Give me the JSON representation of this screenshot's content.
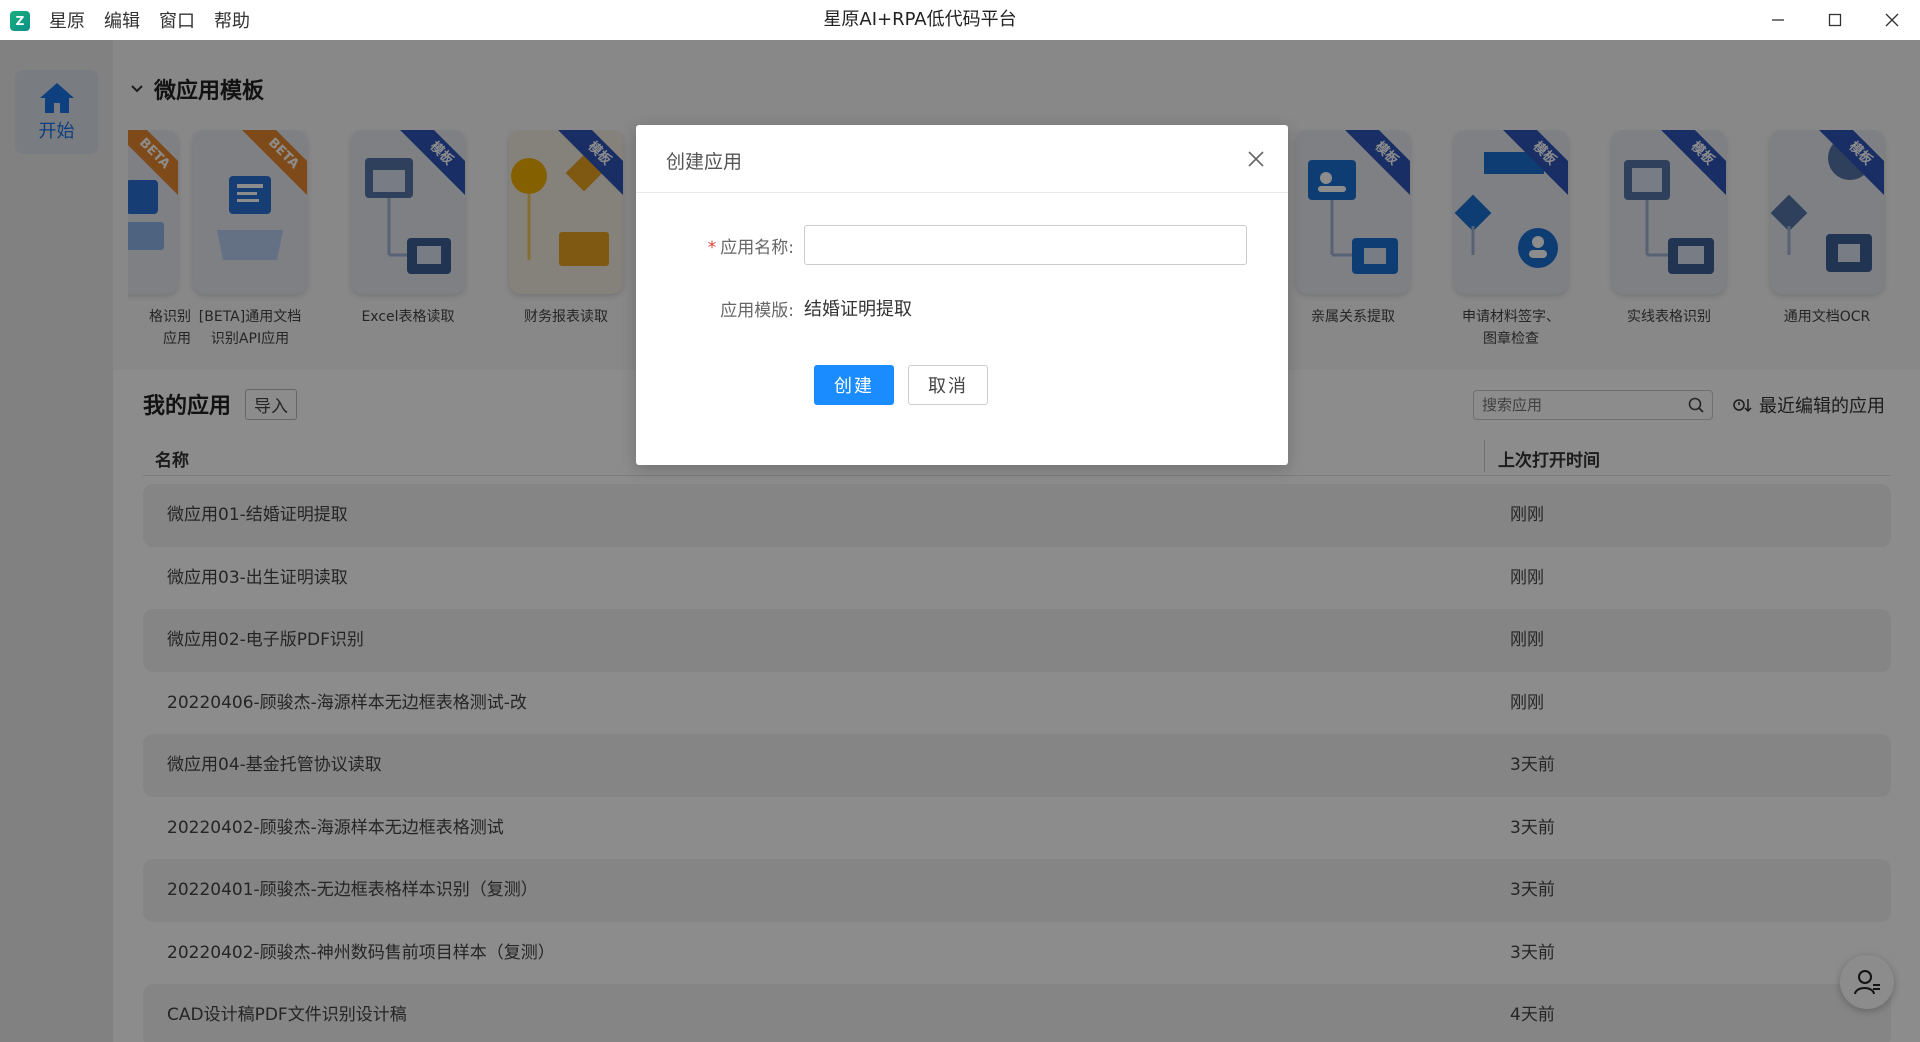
{
  "titlebar": {
    "logo_text": "Z",
    "menu": [
      "星原",
      "编辑",
      "窗口",
      "帮助"
    ],
    "title": "星原AI+RPA低代码平台"
  },
  "sidebar": {
    "start_label": "开始"
  },
  "templates_section": {
    "title": "微应用模板",
    "items": [
      {
        "name": "格识别\n应用",
        "ribbon": "BETA"
      },
      {
        "name": "[BETA]通用文档\n识别API应用",
        "ribbon": "BETA"
      },
      {
        "name": "Excel表格读取",
        "ribbon": "模板"
      },
      {
        "name": "财务报表读取",
        "ribbon": "模板"
      },
      {
        "name": "亲属关系提取",
        "ribbon": "模板"
      },
      {
        "name": "申请材料签字、\n图章检查",
        "ribbon": "模板"
      },
      {
        "name": "实线表格识别",
        "ribbon": "模板"
      },
      {
        "name": "通用文档OCR",
        "ribbon": "模板"
      }
    ]
  },
  "my_apps": {
    "title": "我的应用",
    "import_label": "导入",
    "search_placeholder": "搜索应用",
    "sort_label": "最近编辑的应用",
    "columns": {
      "name": "名称",
      "last_opened": "上次打开时间"
    },
    "rows": [
      {
        "name": "微应用01-结婚证明提取",
        "time": "刚刚"
      },
      {
        "name": "微应用03-出生证明读取",
        "time": "刚刚"
      },
      {
        "name": "微应用02-电子版PDF识别",
        "time": "刚刚"
      },
      {
        "name": "20220406-顾骏杰-海源样本无边框表格测试-改",
        "time": "刚刚"
      },
      {
        "name": "微应用04-基金托管协议读取",
        "time": "3天前"
      },
      {
        "name": "20220402-顾骏杰-海源样本无边框表格测试",
        "time": "3天前"
      },
      {
        "name": "20220401-顾骏杰-无边框表格样本识别（复测）",
        "time": "3天前"
      },
      {
        "name": "20220402-顾骏杰-神州数码售前项目样本（复测）",
        "time": "3天前"
      },
      {
        "name": "CAD设计稿PDF文件识别设计稿",
        "time": "4天前"
      }
    ]
  },
  "modal": {
    "title": "创建应用",
    "name_label": "应用名称:",
    "name_value": "",
    "template_label": "应用模版:",
    "template_value": "结婚证明提取",
    "create_label": "创建",
    "cancel_label": "取消"
  },
  "colors": {
    "accent": "#1a8cff",
    "beta_ribbon": "#e8882f",
    "template_ribbon": "#2f55b8",
    "required": "#e0413b"
  }
}
